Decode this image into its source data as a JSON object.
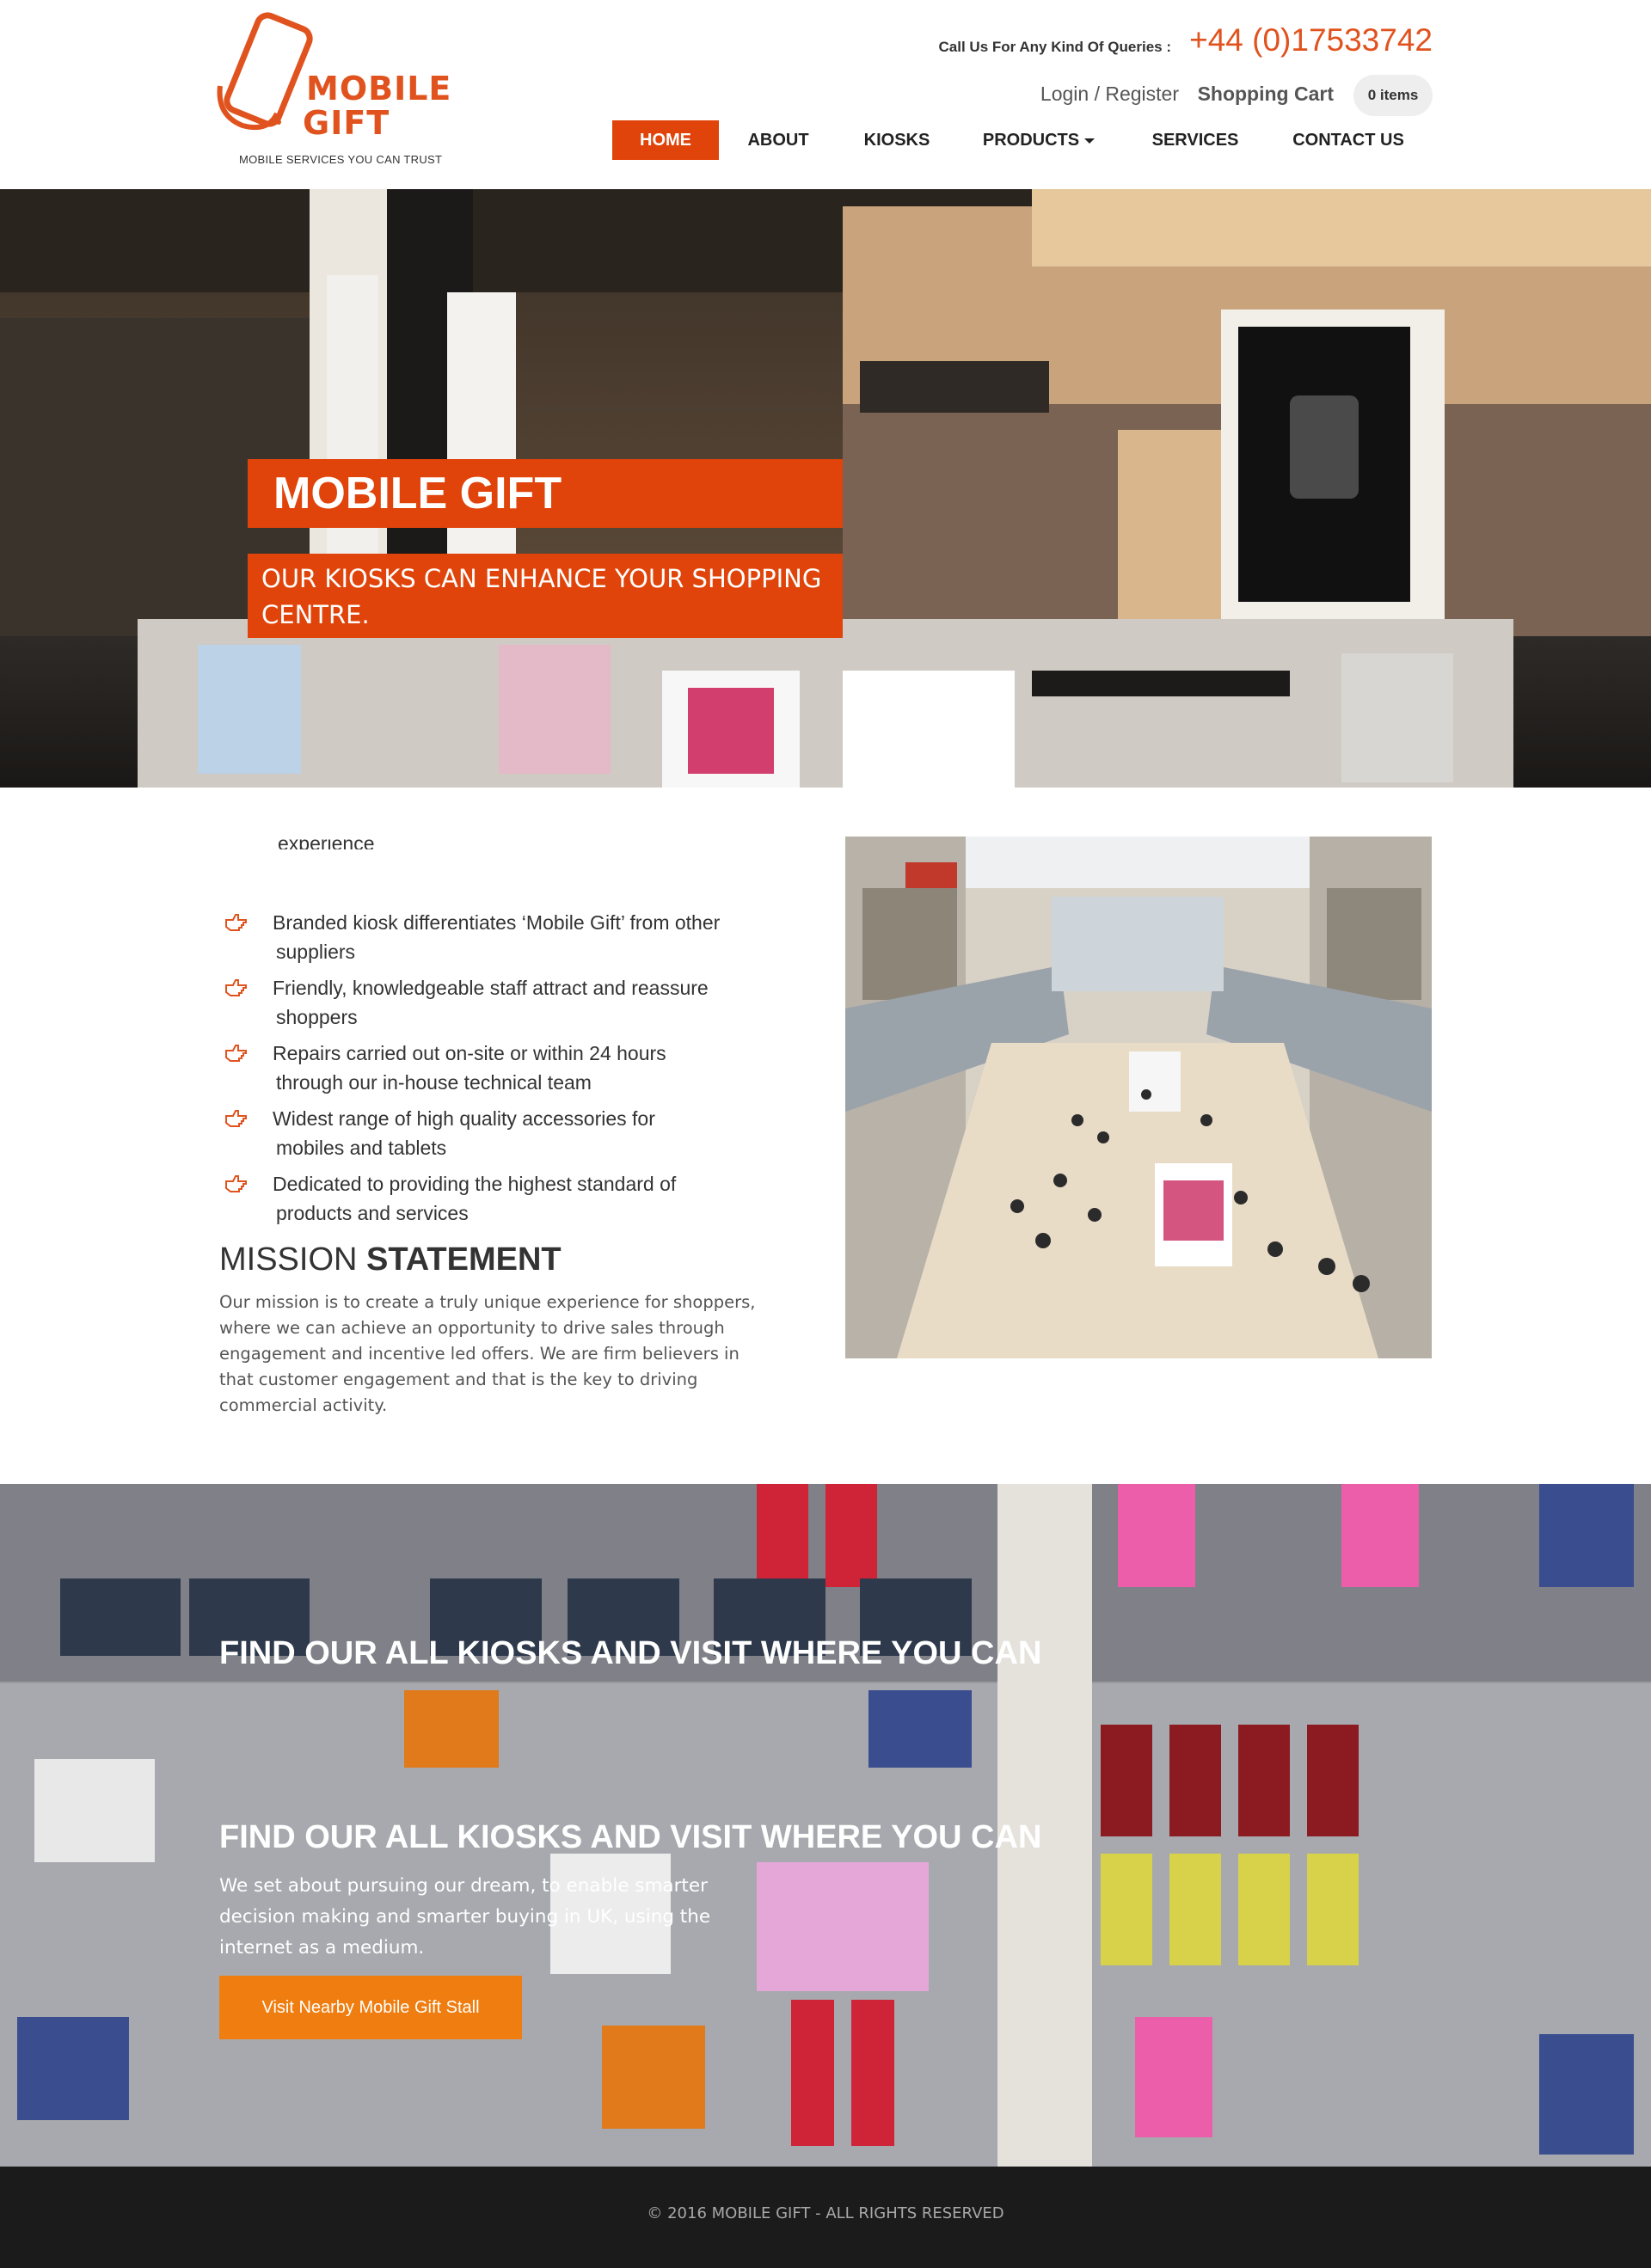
{
  "header": {
    "logo": {
      "line1": "MOBILE",
      "line2": "GIFT",
      "tagline": "MOBILE SERVICES YOU CAN TRUST"
    },
    "call_label": "Call Us For Any Kind Of Queries :",
    "phone": "+44 (0)17533742",
    "login_label": "Login / Register",
    "cart_label": "Shopping Cart",
    "cart_items": "0 items",
    "nav": [
      {
        "label": "HOME",
        "active": true
      },
      {
        "label": "ABOUT"
      },
      {
        "label": "KIOSKS"
      },
      {
        "label": "PRODUCTS",
        "dropdown": true
      },
      {
        "label": "SERVICES"
      },
      {
        "label": "CONTACT US"
      }
    ]
  },
  "hero": {
    "title": "MOBILE GIFT",
    "subtitle": "OUR KIOSKS CAN ENHANCE YOUR SHOPPING CENTRE."
  },
  "features": {
    "cut_item": "experience",
    "items": [
      {
        "line1": "Branded kiosk differentiates ‘Mobile Gift’ from other",
        "line2": "suppliers"
      },
      {
        "line1": "Friendly, knowledgeable staff attract and reassure",
        "line2": "shoppers"
      },
      {
        "line1": "Repairs carried out on-site or within 24 hours",
        "line2": "through our in-house technical team"
      },
      {
        "line1": "Widest range of high quality accessories for",
        "line2": "mobiles and tablets"
      },
      {
        "line1": "Dedicated to providing the highest standard of",
        "line2": "products and services"
      }
    ],
    "icon": "hand-pointer-icon"
  },
  "mission": {
    "heading_light": "MISSION",
    "heading_bold": "STATEMENT",
    "text": "Our mission is to create a truly unique experience for shoppers, where we can achieve an opportunity to drive sales through engagement and incentive led offers. We are firm believers in that customer engagement and that is the key to driving commercial activity."
  },
  "banner": {
    "heading_top": "FIND OUR ALL KIOSKS AND VISIT WHERE YOU CAN",
    "heading": "FIND OUR ALL KIOSKS AND VISIT WHERE YOU CAN",
    "text": "We set about pursuing our dream, to enable smarter decision making and smarter buying in UK, using the internet as a medium.",
    "button_label": "Visit Nearby Mobile Gift Stall"
  },
  "footer": {
    "copyright": "© 2016 MOBILE GIFT - ALL RIGHTS RESERVED"
  },
  "colors": {
    "brand_orange": "#e0440a",
    "logo_orange": "#e0531f",
    "button_orange": "#f07d0f",
    "footer_bg": "#1b1b1b"
  }
}
